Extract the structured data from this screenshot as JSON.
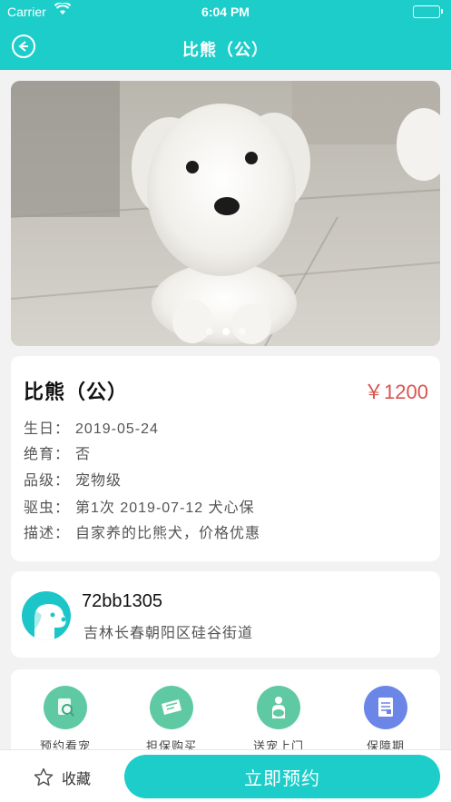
{
  "status_bar": {
    "carrier": "Carrier",
    "time": "6:04 PM"
  },
  "nav": {
    "title": "比熊（公）"
  },
  "gallery": {
    "page_count": 3,
    "active_index": 1
  },
  "pet": {
    "name": "比熊（公）",
    "price": "￥1200",
    "rows": [
      {
        "label": "生日：",
        "value": "2019-05-24"
      },
      {
        "label": "绝育：",
        "value": "否"
      },
      {
        "label": "品级：",
        "value": "宠物级"
      },
      {
        "label": "驱虫：",
        "value": "第1次 2019-07-12 犬心保"
      },
      {
        "label": "描述：",
        "value": "自家养的比熊犬，价格优惠"
      }
    ]
  },
  "owner": {
    "id": "72bb1305",
    "address": "吉林长春朝阳区硅谷街道"
  },
  "services": [
    {
      "label": "预约看宠",
      "icon": "search-doc-icon",
      "color": "#5fc9a4"
    },
    {
      "label": "担保购买",
      "icon": "ticket-icon",
      "color": "#5fc9a4"
    },
    {
      "label": "送宠上门",
      "icon": "pet-delivery-icon",
      "color": "#5fc9a4"
    },
    {
      "label": "保障期",
      "icon": "certificate-icon",
      "color": "#6b86e6"
    }
  ],
  "bottom": {
    "favorite_label": "收藏",
    "reserve_label": "立即预约"
  },
  "colors": {
    "accent": "#1ccdc9",
    "price": "#d9534f"
  }
}
